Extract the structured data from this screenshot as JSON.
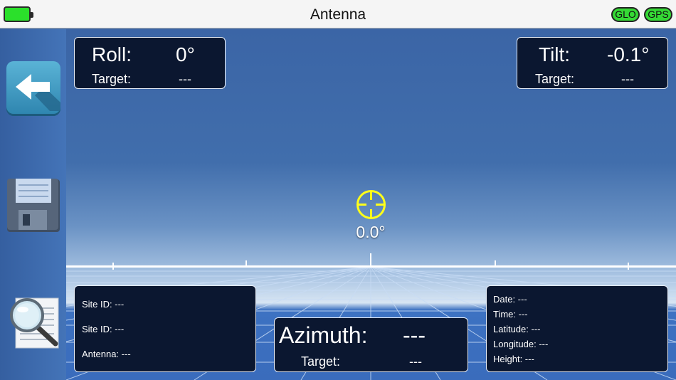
{
  "header": {
    "title": "Antenna",
    "battery_icon": "battery-full-icon",
    "badges": {
      "glo": "GLO",
      "gps": "GPS"
    },
    "badge_color": "#35d935"
  },
  "sidebar": {
    "back_icon": "back-arrow-icon",
    "save_icon": "floppy-disk-icon",
    "search_icon": "magnifier-document-icon"
  },
  "roll": {
    "label": "Roll:",
    "value": "0°",
    "target_label": "Target:",
    "target_value": "---"
  },
  "tilt": {
    "label": "Tilt:",
    "value": "-0.1°",
    "target_label": "Target:",
    "target_value": "---"
  },
  "center": {
    "value": "0.0°",
    "reticle_color": "#ffff1a"
  },
  "azimuth": {
    "label": "Azimuth:",
    "value": "---",
    "target_label": "Target:",
    "target_value": "---"
  },
  "site_panel": {
    "line1": "Site ID: ---",
    "line2": "Site ID: ---",
    "line3": "Antenna: ---"
  },
  "info_panel": {
    "date": "Date: ---",
    "time": "Time: ---",
    "latitude": "Latitude: ---",
    "longitude": "Longitude: ---",
    "height": "Height: ---"
  }
}
